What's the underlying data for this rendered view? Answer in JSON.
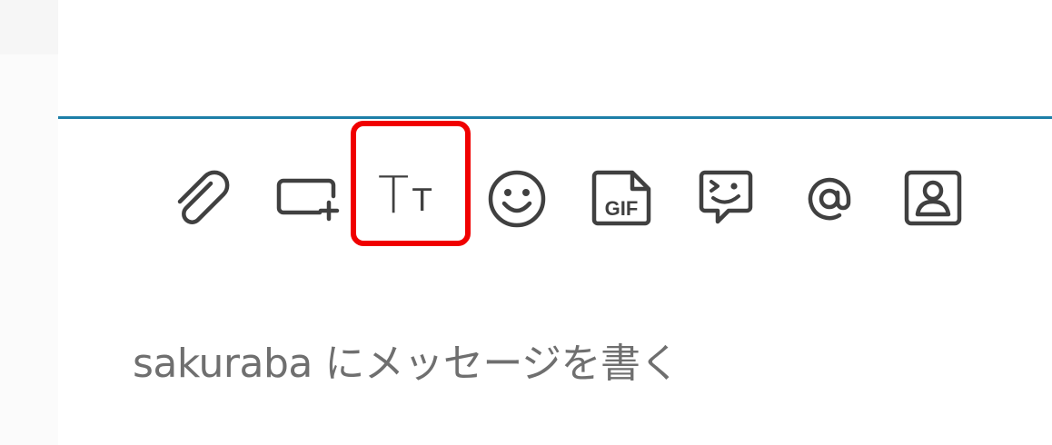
{
  "toolbar": {
    "icons": [
      {
        "name": "paperclip-icon",
        "label": "attach"
      },
      {
        "name": "shortcuts-icon",
        "label": "shortcuts"
      },
      {
        "name": "text-format-icon",
        "label": "Tт"
      },
      {
        "name": "emoji-icon",
        "label": "emoji"
      },
      {
        "name": "gif-icon",
        "label": "GIF"
      },
      {
        "name": "sticker-icon",
        "label": "sticker"
      },
      {
        "name": "mention-icon",
        "label": "@"
      },
      {
        "name": "contact-icon",
        "label": "contact"
      }
    ],
    "format_big": "T",
    "format_small": "T",
    "gif_text": "GIF"
  },
  "composer": {
    "placeholder": "sakuraba にメッセージを書く"
  },
  "colors": {
    "accent_line": "#1d7fa8",
    "highlight": "#f00000",
    "icon": "#404040",
    "placeholder": "#6f6f6f"
  }
}
